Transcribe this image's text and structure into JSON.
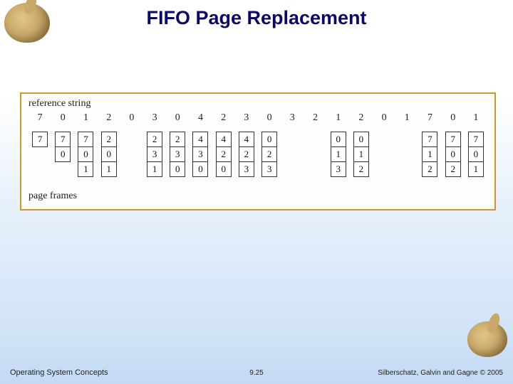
{
  "title": "FIFO Page Replacement",
  "diagram": {
    "label_ref": "reference string",
    "label_frames": "page frames",
    "reference_string": [
      "7",
      "0",
      "1",
      "2",
      "0",
      "3",
      "0",
      "4",
      "2",
      "3",
      "0",
      "3",
      "2",
      "1",
      "2",
      "0",
      "1",
      "7",
      "0",
      "1"
    ],
    "columns": [
      {
        "show": true,
        "frames": [
          "7"
        ]
      },
      {
        "show": true,
        "frames": [
          "7",
          "0"
        ]
      },
      {
        "show": true,
        "frames": [
          "7",
          "0",
          "1"
        ]
      },
      {
        "show": true,
        "frames": [
          "2",
          "0",
          "1"
        ]
      },
      {
        "show": false,
        "frames": []
      },
      {
        "show": true,
        "frames": [
          "2",
          "3",
          "1"
        ]
      },
      {
        "show": true,
        "frames": [
          "2",
          "3",
          "0"
        ]
      },
      {
        "show": true,
        "frames": [
          "4",
          "3",
          "0"
        ]
      },
      {
        "show": true,
        "frames": [
          "4",
          "2",
          "0"
        ]
      },
      {
        "show": true,
        "frames": [
          "4",
          "2",
          "3"
        ]
      },
      {
        "show": true,
        "frames": [
          "0",
          "2",
          "3"
        ]
      },
      {
        "show": false,
        "frames": []
      },
      {
        "show": false,
        "frames": []
      },
      {
        "show": true,
        "frames": [
          "0",
          "1",
          "3"
        ]
      },
      {
        "show": true,
        "frames": [
          "0",
          "1",
          "2"
        ]
      },
      {
        "show": false,
        "frames": []
      },
      {
        "show": false,
        "frames": []
      },
      {
        "show": true,
        "frames": [
          "7",
          "1",
          "2"
        ]
      },
      {
        "show": true,
        "frames": [
          "7",
          "0",
          "2"
        ]
      },
      {
        "show": true,
        "frames": [
          "7",
          "0",
          "1"
        ]
      }
    ]
  },
  "footer": {
    "left": "Operating System Concepts",
    "center": "9.25",
    "right": "Silberschatz, Galvin and Gagne © 2005"
  }
}
